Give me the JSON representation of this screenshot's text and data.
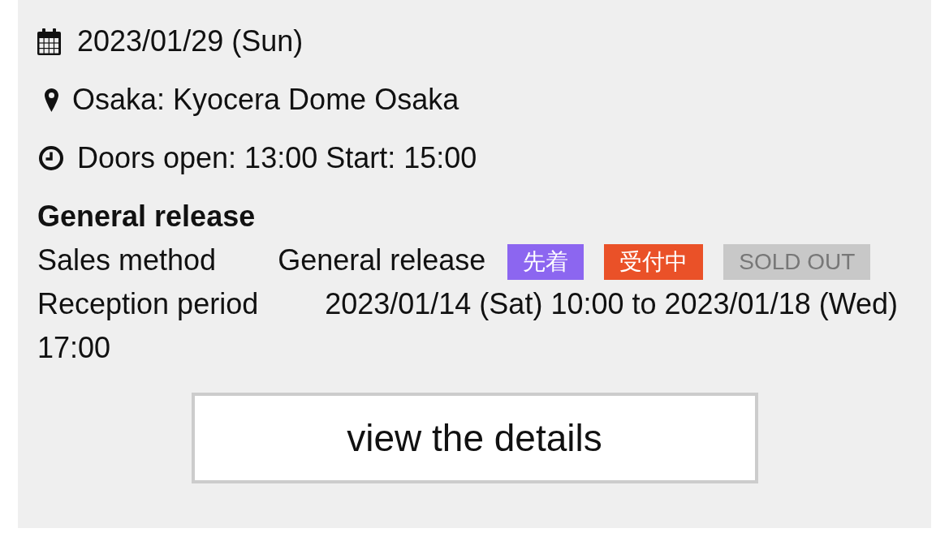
{
  "info": [
    {
      "kind": "date",
      "text": "2023/01/29 (Sun)"
    },
    {
      "kind": "venue",
      "text": "Osaka: Kyocera Dome Osaka"
    },
    {
      "kind": "time",
      "text": "Doors open: 13:00 Start: 15:00"
    }
  ],
  "release": {
    "title": "General release",
    "rows": [
      {
        "label": "Sales method",
        "value_lines": [
          "General release"
        ],
        "badges": [
          {
            "label": "先着",
            "color": "#8c66f0",
            "active": true
          },
          {
            "label": "受付中",
            "color": "#ea5128",
            "active": true
          },
          {
            "label": "SOLD OUT",
            "color": "#c8c8c8",
            "active": false
          }
        ]
      },
      {
        "label": "Reception period",
        "value_lines": [
          "2023/01/14 (Sat) 10:00 to 2023/01/18 (Wed)",
          "17:00"
        ]
      }
    ]
  },
  "button": {
    "label": "view the details"
  }
}
